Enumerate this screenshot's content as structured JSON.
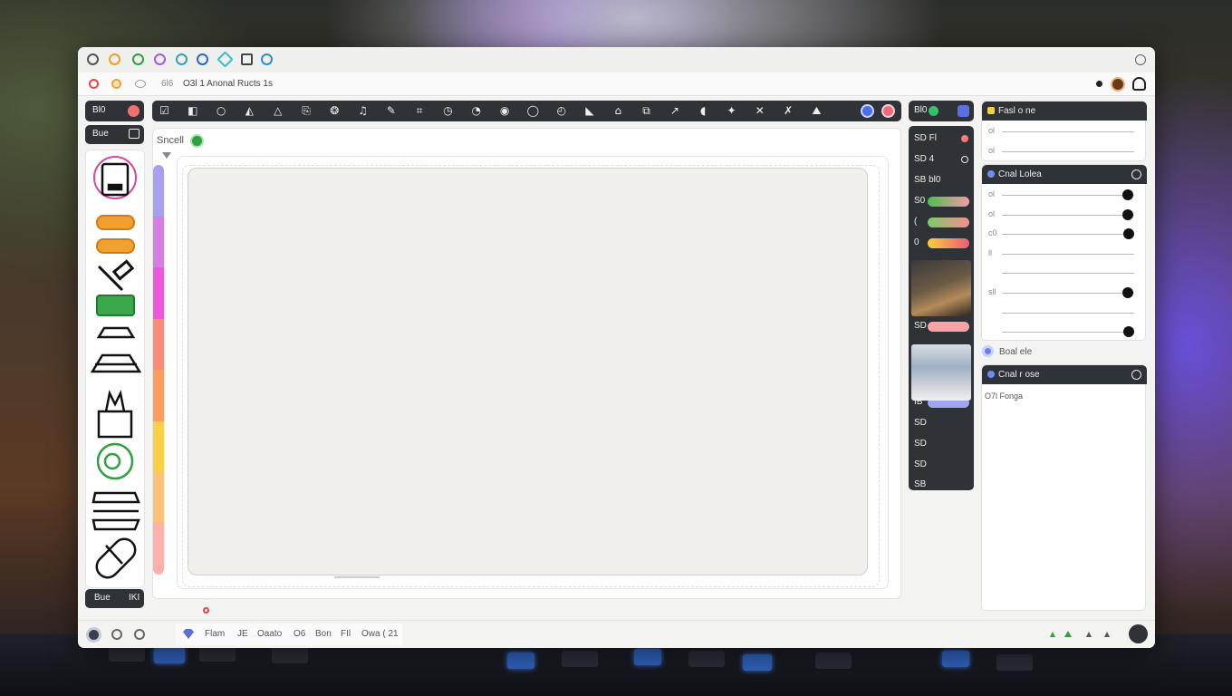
{
  "tabs": [
    "chrome-icon",
    "orange-drop-icon",
    "green-a-icon",
    "purple-swirl-icon",
    "teal-ring-icon",
    "blue-drop-icon",
    "diamond-icon",
    "pen-icon",
    "globe-icon"
  ],
  "address": {
    "prefix": "6l6",
    "text": "O3l 1 Anonal Ructs 1s"
  },
  "toolbar": {
    "icons": [
      "check-icon",
      "panel-icon",
      "circle-icon",
      "shape-icon",
      "triangle-icon",
      "save-icon",
      "stamp-icon",
      "bell-icon",
      "pen-icon",
      "crop-icon",
      "clock-icon",
      "meter-icon",
      "record-icon",
      "ellipse-icon",
      "timer-icon",
      "chart-icon",
      "house-icon",
      "copy-icon",
      "path-icon",
      "node-icon",
      "wand-icon",
      "close-icon",
      "erase-icon",
      "image-icon"
    ]
  },
  "left": {
    "top_label": "Bl0",
    "sub_label": "Bue",
    "bottom_label": "Bue",
    "bottom_value": "IKI"
  },
  "canvas": {
    "title": "Sncell"
  },
  "strip_colors": [
    "#a7a0ef",
    "#d57ee4",
    "#ec57dc",
    "#ff8a7a",
    "#ff9d5e",
    "#ffd045",
    "#ffc07a",
    "#ffb0a8"
  ],
  "mid": {
    "rows": [
      {
        "label": "SD Fl",
        "bar": null,
        "dot": "#f47c7c"
      },
      {
        "label": "SD 4",
        "bar": null,
        "dot": null
      },
      {
        "label": "SB bl0",
        "bar": null,
        "dot": null
      },
      {
        "label": "S0",
        "bar": "linear-gradient(90deg,#4fbf4f,#f59aa5)",
        "dot": null
      },
      {
        "label": "(",
        "bar": "linear-gradient(90deg,#7bc96b,#f58f8f)",
        "dot": null
      },
      {
        "label": "0",
        "bar": "linear-gradient(90deg,#f5d13a,#ef5a7a)",
        "dot": null
      },
      {
        "label": "SD",
        "bar": "#f7a3a5",
        "dot": null
      },
      {
        "label": "IB",
        "bar": "#9ea6f0",
        "dot": null
      },
      {
        "label": "SD",
        "bar": null,
        "dot": null
      },
      {
        "label": "SD",
        "bar": null,
        "dot": null
      },
      {
        "label": "SD",
        "bar": null,
        "dot": null
      },
      {
        "label": "SB",
        "bar": null,
        "dot": null
      }
    ]
  },
  "right": {
    "panel1": {
      "title": "Fasl o ne"
    },
    "panel2": {
      "title": "Cnal Lolea",
      "sliders": [
        {
          "label": "ol",
          "value": 0.95
        },
        {
          "label": "ol",
          "value": 0.95
        },
        {
          "label": "c0",
          "value": 0.96
        },
        {
          "label": "ll",
          "value": null
        },
        {
          "label": "",
          "value": null
        },
        {
          "label": "sll",
          "value": 0.95
        },
        {
          "label": "",
          "value": null
        },
        {
          "label": "",
          "value": 0.96
        }
      ]
    },
    "mid_label": "Boal ele",
    "panel3": {
      "title": "Cnal r ose",
      "body": "O7l Fonga"
    }
  },
  "status": {
    "items": [
      "Flam",
      "JE",
      "Oaato",
      "O6",
      "Bon",
      "FIl",
      "Owa ( 21"
    ]
  },
  "accent": "#2f3237"
}
